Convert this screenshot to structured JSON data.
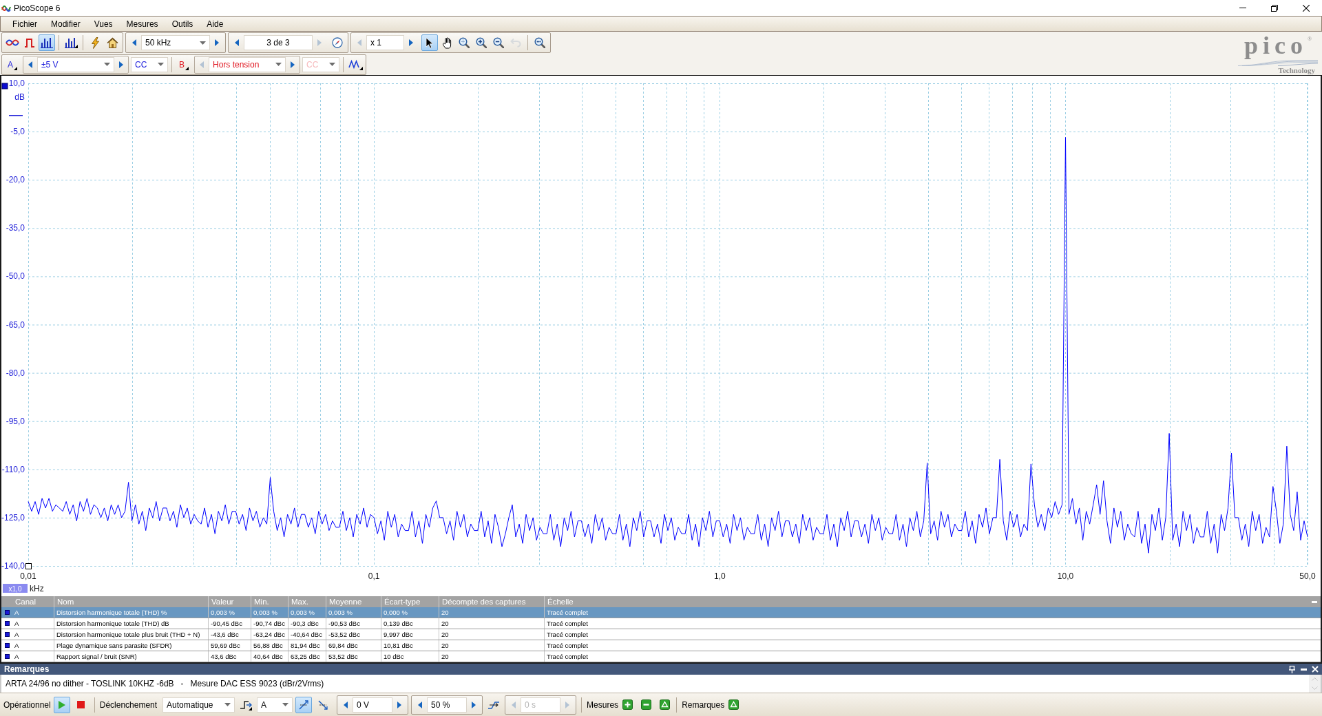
{
  "window": {
    "title": "PicoScope 6"
  },
  "menu": [
    "Fichier",
    "Modifier",
    "Vues",
    "Mesures",
    "Outils",
    "Aide"
  ],
  "toolbar": {
    "modes": [
      {
        "kind": "scope",
        "selected": false
      },
      {
        "kind": "persistence",
        "selected": false
      },
      {
        "kind": "spectrum",
        "selected": true
      }
    ],
    "timebase": {
      "value": "50 kHz",
      "prev_disabled": false,
      "next_disabled": false
    },
    "buffer": {
      "value": "3 de 3",
      "prev_disabled": false,
      "next_disabled": true
    },
    "zoom": {
      "value": "x 1",
      "prev_disabled": true,
      "next_disabled": false
    },
    "tools": [
      {
        "kind": "pointer",
        "selected": true,
        "disabled": false
      },
      {
        "kind": "hand",
        "selected": false,
        "disabled": false
      },
      {
        "kind": "zoom_fit",
        "selected": false,
        "disabled": false
      },
      {
        "kind": "zoom_in",
        "selected": false,
        "disabled": false
      },
      {
        "kind": "zoom_out",
        "selected": false,
        "disabled": false
      },
      {
        "kind": "undo_zoom",
        "selected": false,
        "disabled": true
      }
    ]
  },
  "channels": [
    {
      "label": "A",
      "color": "#1c1cdc",
      "range": "±5 V",
      "prev_disabled": false,
      "next_disabled": false,
      "coupling": "CC",
      "coupling_disabled": false
    },
    {
      "label": "B",
      "color": "#e0141e",
      "range": "Hors tension",
      "prev_disabled": true,
      "next_disabled": false,
      "coupling": "CC",
      "coupling_disabled": true
    }
  ],
  "logo": {
    "name": "pico",
    "mark": "®",
    "tagline": "Technology"
  },
  "plot": {
    "zoom_badge": "x1,0",
    "chart_data": {
      "type": "line",
      "xlabel": "kHz",
      "ylabel": "dB",
      "grid": true,
      "ylim": [
        -140,
        10
      ],
      "yticks": [
        {
          "value": 10,
          "label": "10,0"
        },
        {
          "value": -5,
          "label": "-5,0"
        },
        {
          "value": -20,
          "label": "-20,0"
        },
        {
          "value": -35,
          "label": "-35,0"
        },
        {
          "value": -50,
          "label": "-50,0"
        },
        {
          "value": -65,
          "label": "-65,0"
        },
        {
          "value": -80,
          "label": "-80,0"
        },
        {
          "value": -95,
          "label": "-95,0"
        },
        {
          "value": -110,
          "label": "-110,0"
        },
        {
          "value": -125,
          "label": "-125,0"
        },
        {
          "value": -140,
          "label": "-140,0"
        }
      ],
      "categories": [
        "0,01",
        null,
        null,
        null,
        null,
        null,
        null,
        null,
        null,
        null,
        null,
        null,
        null,
        null,
        null,
        null,
        null,
        null,
        null,
        null,
        null,
        null,
        null,
        null,
        null,
        null,
        null,
        null,
        null,
        null,
        null,
        null,
        null,
        null,
        null,
        null,
        null,
        null,
        null,
        null,
        null,
        null,
        null,
        null,
        null,
        null,
        null,
        null,
        null,
        null,
        null,
        null,
        null,
        null,
        null,
        null,
        null,
        null,
        null,
        null,
        null,
        null,
        null,
        null,
        null,
        null,
        null,
        null,
        null,
        null,
        null,
        null,
        null,
        null,
        null,
        null,
        null,
        null,
        null,
        null,
        null,
        null,
        null,
        null,
        null,
        null,
        null,
        null,
        null,
        null,
        null,
        null,
        null,
        null,
        null,
        null,
        null,
        null,
        null,
        null,
        "0,1",
        null,
        null,
        null,
        null,
        null,
        null,
        null,
        null,
        null,
        null,
        null,
        null,
        null,
        null,
        null,
        null,
        null,
        null,
        null,
        null,
        null,
        null,
        null,
        null,
        null,
        null,
        null,
        null,
        null,
        null,
        null,
        null,
        null,
        null,
        null,
        null,
        null,
        null,
        null,
        null,
        null,
        null,
        null,
        null,
        null,
        null,
        null,
        null,
        null,
        null,
        null,
        null,
        null,
        null,
        null,
        null,
        null,
        null,
        null,
        null,
        null,
        null,
        null,
        null,
        null,
        null,
        null,
        null,
        null,
        null,
        null,
        null,
        null,
        null,
        null,
        null,
        null,
        null,
        null,
        null,
        null,
        null,
        null,
        null,
        null,
        null,
        null,
        null,
        null,
        null,
        null,
        null,
        null,
        null,
        null,
        null,
        null,
        null,
        null,
        "1,0",
        null,
        null,
        null,
        null,
        null,
        null,
        null,
        null,
        null,
        null,
        null,
        null,
        null,
        null,
        null,
        null,
        null,
        null,
        null,
        null,
        null,
        null,
        null,
        null,
        null,
        null,
        null,
        null,
        null,
        null,
        null,
        null,
        null,
        null,
        null,
        null,
        null,
        null,
        null,
        null,
        null,
        null,
        null,
        null,
        null,
        null,
        null,
        null,
        null,
        null,
        null,
        null,
        null,
        null,
        null,
        null,
        null,
        null,
        null,
        null,
        null,
        null,
        null,
        null,
        null,
        null,
        null,
        null,
        null,
        null,
        null,
        null,
        null,
        null,
        null,
        null,
        null,
        null,
        null,
        null,
        null,
        null,
        null,
        null,
        null,
        null,
        null,
        null,
        null,
        null,
        null,
        null,
        null,
        null,
        null,
        null,
        null,
        null,
        null,
        "10,0",
        null,
        null,
        null,
        null,
        null,
        null,
        null,
        null,
        null,
        null,
        null,
        null,
        null,
        null,
        null,
        null,
        null,
        null,
        null,
        null,
        null,
        null,
        null,
        null,
        null,
        null,
        null,
        null,
        null,
        null,
        null,
        null,
        null,
        null,
        null,
        null,
        null,
        null,
        null,
        null,
        null,
        null,
        null,
        null,
        null,
        null,
        null,
        null,
        null,
        null,
        null,
        null,
        null,
        null,
        null,
        null,
        null,
        null,
        null,
        null,
        null,
        null,
        null,
        null,
        null,
        null,
        null,
        null,
        null,
        "50,0"
      ],
      "series": [
        {
          "color": "#0000ff",
          "values": [
            -120,
            -123,
            -120,
            -124,
            -119,
            -122,
            -119,
            -123,
            -121,
            -122,
            -123,
            -120,
            -124,
            -121,
            -126,
            -120,
            -123,
            -119,
            -124,
            -121,
            -122,
            -125,
            -122,
            -126,
            -121,
            -124,
            -121,
            -125,
            -123,
            -114,
            -126,
            -121,
            -127,
            -123,
            -129,
            -122,
            -125,
            -120,
            -126,
            -122,
            -122,
            -126,
            -123,
            -128,
            -121,
            -125,
            -122,
            -127,
            -124,
            -126,
            -127,
            -122,
            -128,
            -124,
            -130,
            -123,
            -126,
            -121,
            -127,
            -123,
            -123,
            -127,
            -124,
            -129,
            -122,
            -126,
            -123,
            -128,
            -125,
            -127,
            -112.5,
            -123,
            -129,
            -125,
            -131,
            -124,
            -127,
            -122,
            -128,
            -124,
            -124,
            -128,
            -125,
            -130,
            -123,
            -127,
            -124,
            -129,
            -126,
            -128,
            -128,
            -123,
            -129,
            -125,
            -131,
            -124,
            -127,
            -122,
            -128,
            -124,
            -125,
            -130,
            -126,
            -132,
            -123,
            -128,
            -124,
            -131,
            -127,
            -129,
            -129,
            -123,
            -131,
            -126,
            -133,
            -124,
            -128,
            -122,
            -119.8,
            -125,
            -125,
            -130,
            -126,
            -132,
            -123,
            -128,
            -124,
            -131,
            -127,
            -129,
            -129,
            -123,
            -131,
            -126,
            -133,
            -124,
            -128,
            -134,
            -130,
            -125,
            -121,
            -131,
            -127,
            -133,
            -124,
            -129,
            -125,
            -132,
            -128,
            -130,
            -130,
            -124,
            -132,
            -127,
            -134,
            -125,
            -129,
            -123,
            -131,
            -126,
            -126,
            -131,
            -127,
            -133,
            -124,
            -129,
            -125,
            -132,
            -128,
            -130,
            -130,
            -124,
            -132,
            -127,
            -134,
            -125,
            -129,
            -123,
            -131,
            -126,
            -126,
            -131,
            -127,
            -133,
            -124,
            -129,
            -125,
            -132,
            -128,
            -130,
            -130,
            -124,
            -132,
            -127,
            -134,
            -125,
            -129,
            -123,
            -131,
            -126,
            -126,
            -131,
            -127,
            -133,
            -124,
            -129,
            -125,
            -132,
            -128,
            -130,
            -130,
            -124,
            -132,
            -127,
            -134,
            -125,
            -129,
            -123,
            -131,
            -126,
            -126,
            -131,
            -127,
            -133,
            -124,
            -129,
            -125,
            -132,
            -128,
            -130,
            -130,
            -124,
            -132,
            -127,
            -134,
            -125,
            -129,
            -123,
            -131,
            -126,
            -126,
            -131,
            -127,
            -133,
            -124,
            -129,
            -125,
            -132,
            -128,
            -130,
            -130,
            -124,
            -132,
            -127,
            -134,
            -125,
            -129,
            -123,
            -131,
            -126,
            -108,
            -130,
            -126,
            -132,
            -123,
            -128,
            -124,
            -131,
            -127,
            -129,
            -129,
            -123,
            -131,
            -126,
            -133,
            -124,
            -128,
            -122,
            -130,
            -125,
            -125,
            -106.9,
            -126,
            -132,
            -123,
            -128,
            -124,
            -131,
            -127,
            -129,
            -108.3,
            -121,
            -128,
            -124,
            -129,
            -122,
            -125,
            -120,
            -124,
            -121,
            -6.8,
            -124,
            -119,
            -127,
            -122,
            -132,
            -123,
            -127,
            -121,
            -114.8,
            -124,
            -113.5,
            -126,
            -133,
            -122,
            -128,
            -123,
            -132,
            -127,
            -130,
            -131,
            -123,
            -133,
            -127,
            -136,
            -124,
            -129,
            -122,
            -132,
            -125,
            -98.8,
            -132,
            -127,
            -134,
            -123,
            -129,
            -124,
            -133,
            -128,
            -131,
            -131,
            -123,
            -133,
            -127,
            -136,
            -124,
            -129,
            -122,
            -104.9,
            -125,
            -125,
            -132,
            -127,
            -134,
            -123,
            -129,
            -124,
            -133,
            -128,
            -131,
            -115.3,
            -123,
            -133,
            -127,
            -102.8,
            -124,
            -129,
            -117,
            -132,
            -126,
            -131
          ]
        }
      ]
    }
  },
  "measurements": {
    "columns": [
      "Canal",
      "Nom",
      "Valeur",
      "Min.",
      "Max.",
      "Moyenne",
      "Écart-type",
      "Décompte des captures",
      "Échelle"
    ],
    "rows": [
      {
        "selected": true,
        "cells": [
          "A",
          "Distorsion harmonique totale (THD) %",
          "0,003 %",
          "0,003 %",
          "0,003 %",
          "0,003 %",
          "0,000 %",
          "20",
          "Tracé complet"
        ]
      },
      {
        "selected": false,
        "cells": [
          "A",
          "Distorsion harmonique totale (THD) dB",
          "-90,45 dBc",
          "-90,74 dBc",
          "-90,3 dBc",
          "-90,53 dBc",
          "0,139 dBc",
          "20",
          "Tracé complet"
        ]
      },
      {
        "selected": false,
        "cells": [
          "A",
          "Distorsion harmonique totale plus bruit (THD + N)",
          "-43,6 dBc",
          "-63,24 dBc",
          "-40,64 dBc",
          "-53,52 dBc",
          "9,997 dBc",
          "20",
          "Tracé complet"
        ]
      },
      {
        "selected": false,
        "cells": [
          "A",
          "Plage dynamique sans parasite (SFDR)",
          "59,69 dBc",
          "56,88 dBc",
          "81,94 dBc",
          "69,84 dBc",
          "10,81 dBc",
          "20",
          "Tracé complet"
        ]
      },
      {
        "selected": false,
        "cells": [
          "A",
          "Rapport signal / bruit (SNR)",
          "43,6 dBc",
          "40,64 dBc",
          "63,25 dBc",
          "53,52 dBc",
          "10 dBc",
          "20",
          "Tracé complet"
        ]
      }
    ]
  },
  "notes": {
    "title": "Remarques",
    "text": "ARTA 24/96 no dither - TOSLINK 10KHZ -6dB   -   Mesure DAC ESS 9023 (dBr/2Vrms)"
  },
  "status_bar": {
    "state_label": "Opérationnel",
    "transport": [
      {
        "kind": "run",
        "selected": true
      },
      {
        "kind": "stop",
        "selected": false
      }
    ],
    "trigger_label": "Déclenchement",
    "trigger_mode": "Automatique",
    "trigger_source": "A",
    "edges": [
      {
        "kind": "rising",
        "selected": true
      },
      {
        "kind": "falling",
        "selected": false
      }
    ],
    "threshold": {
      "value": "0 V",
      "prev_disabled": false,
      "next_disabled": false
    },
    "position": {
      "value": "50 %",
      "prev_disabled": false,
      "next_disabled": false
    },
    "delay": {
      "value": "0 s",
      "prev_disabled": true,
      "next_disabled": true,
      "disabled": true
    },
    "measurements_label": "Mesures",
    "notes_label": "Remarques"
  }
}
